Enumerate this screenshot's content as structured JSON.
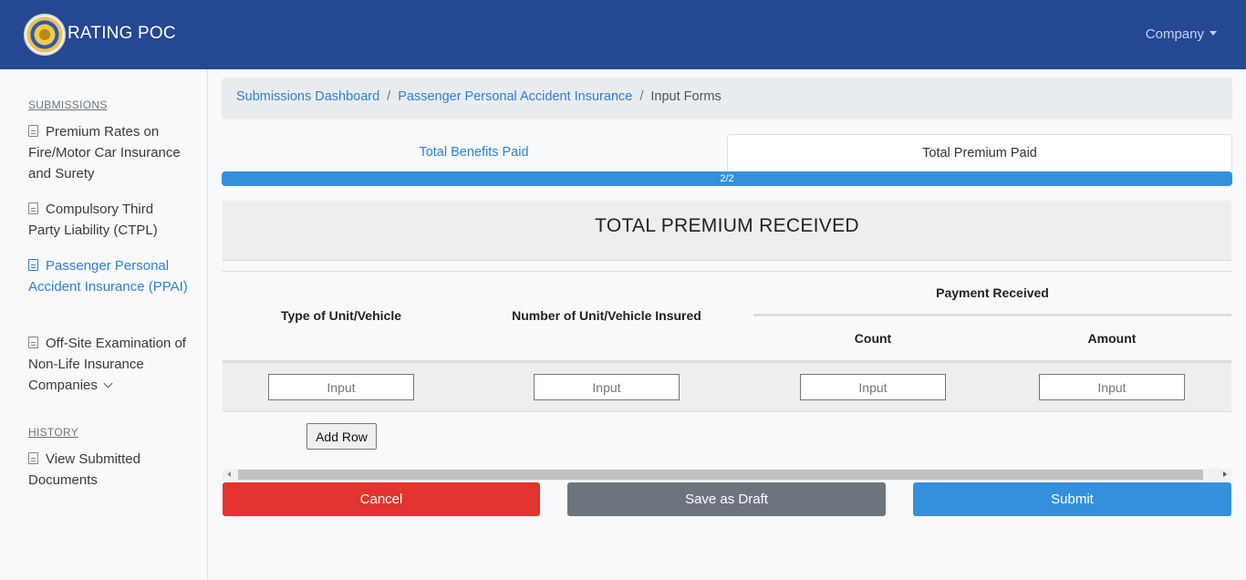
{
  "navbar": {
    "brand": "RATING POC",
    "company_menu": "Company"
  },
  "sidebar": {
    "submissions_title": "SUBMISSIONS",
    "submissions": [
      {
        "label": "Premium Rates on Fire/Motor Car Insurance and Surety",
        "icon": "document-icon"
      },
      {
        "label": "Compulsory Third Party Liability (CTPL)",
        "icon": "document-icon"
      },
      {
        "label": "Passenger Personal Accident Insurance (PPAI)",
        "icon": "document-icon",
        "active": true
      },
      {
        "label": "Off-Site Examination of Non-Life Insurance Companies",
        "icon": "document-icon",
        "expandable": true
      }
    ],
    "history_title": "HISTORY",
    "history": [
      {
        "label": "View Submitted Documents",
        "icon": "document-icon"
      }
    ]
  },
  "breadcrumb": {
    "items": [
      "Submissions Dashboard",
      "Passenger Personal Accident Insurance"
    ],
    "current": "Input Forms"
  },
  "tabs": [
    {
      "label": "Total Benefits Paid",
      "active": false
    },
    {
      "label": "Total Premium Paid",
      "active": true
    }
  ],
  "progress": {
    "label": "2/2",
    "value": 2,
    "max": 2
  },
  "form": {
    "title": "TOTAL PREMIUM RECEIVED",
    "headers": {
      "type_of_unit": "Type of Unit/Vehicle",
      "number_insured": "Number of Unit/Vehicle Insured",
      "payment_received": "Payment Received",
      "count": "Count",
      "amount": "Amount"
    },
    "row_placeholder": "Input",
    "add_row_label": "Add Row"
  },
  "actions": {
    "cancel": "Cancel",
    "save_draft": "Save as Draft",
    "submit": "Submit"
  },
  "colors": {
    "navbar": "#254893",
    "primary": "#3490dc",
    "danger": "#e3342f",
    "secondary": "#6c757d"
  }
}
